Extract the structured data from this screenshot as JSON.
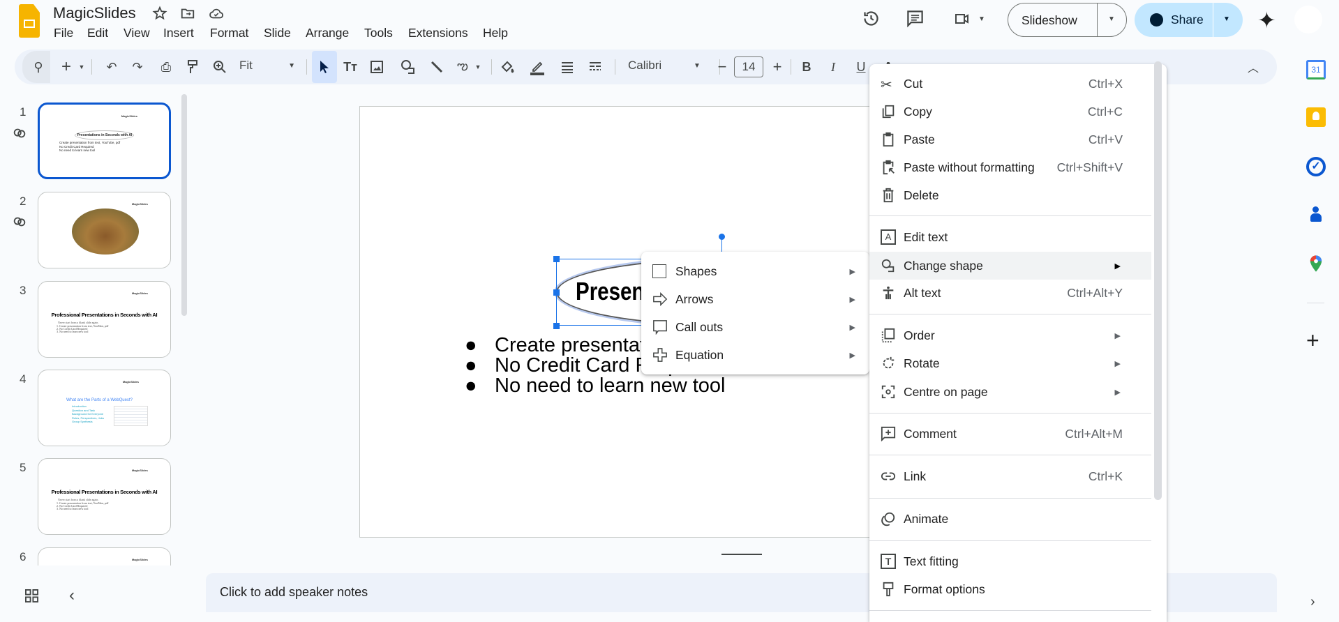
{
  "app": {
    "title": "MagicSlides",
    "menu": [
      "File",
      "Edit",
      "View",
      "Insert",
      "Format",
      "Slide",
      "Arrange",
      "Tools",
      "Extensions",
      "Help"
    ]
  },
  "header": {
    "slideshow_label": "Slideshow",
    "share_label": "Share"
  },
  "toolbar": {
    "zoom_value": "Fit",
    "font_name": "Calibri",
    "font_size": "14",
    "bold": "B",
    "italic": "I",
    "underline": "U"
  },
  "filmstrip": {
    "slides": [
      {
        "number": "1",
        "logo": "MagicSlides",
        "title": "Presentations in Seconds with AI",
        "bullets": [
          "Create presentation from text, YouTube, pdf",
          "No Credit Card Required",
          "No need to learn new tool"
        ]
      },
      {
        "number": "2",
        "logo": "MagicSlides"
      },
      {
        "number": "3",
        "logo": "MagicSlides",
        "title": "Professional Presentations in Seconds with AI",
        "subtitle": "Never start from a blank slide again.",
        "bullets": [
          "1. Create presentation from text, YouTube, pdf",
          "2. No Credit Card Required",
          "3. No need to learn new tool"
        ]
      },
      {
        "number": "4",
        "logo": "MagicSlides",
        "title": "What are the Parts of a WebQuest?",
        "bullets": [
          "Introduction",
          "Question and Task",
          "Background for Everyone",
          "Roles, Perspectives, Jobs",
          "Group Synthesis"
        ]
      },
      {
        "number": "5",
        "logo": "MagicSlides",
        "title": "Professional Presentations in Seconds with AI",
        "subtitle": "Never start from a blank slide again.",
        "bullets": [
          "1. Create presentation from text, YouTube, pdf",
          "2. No Credit Card Required",
          "3. No need to learn new tool"
        ]
      },
      {
        "number": "6",
        "logo": "MagicSlides"
      }
    ]
  },
  "slide": {
    "title": "Presentations in Seconds with AI",
    "bullets": [
      "Create presentation from text, YouTube, pdf",
      "No Credit Card Required",
      "No need to learn new tool"
    ]
  },
  "notes": {
    "placeholder": "Click to add speaker notes"
  },
  "context_menu": {
    "items": [
      {
        "label": "Cut",
        "shortcut": "Ctrl+X"
      },
      {
        "label": "Copy",
        "shortcut": "Ctrl+C"
      },
      {
        "label": "Paste",
        "shortcut": "Ctrl+V"
      },
      {
        "label": "Paste without formatting",
        "shortcut": "Ctrl+Shift+V"
      },
      {
        "label": "Delete"
      },
      {
        "label": "Edit text"
      },
      {
        "label": "Change shape"
      },
      {
        "label": "Alt text",
        "shortcut": "Ctrl+Alt+Y"
      },
      {
        "label": "Order"
      },
      {
        "label": "Rotate"
      },
      {
        "label": "Centre on page"
      },
      {
        "label": "Comment",
        "shortcut": "Ctrl+Alt+M"
      },
      {
        "label": "Link",
        "shortcut": "Ctrl+K"
      },
      {
        "label": "Animate"
      },
      {
        "label": "Text fitting"
      },
      {
        "label": "Format options"
      }
    ]
  },
  "submenu": {
    "items": [
      {
        "label": "Shapes"
      },
      {
        "label": "Arrows"
      },
      {
        "label": "Call outs"
      },
      {
        "label": "Equation"
      }
    ]
  },
  "colors": {
    "accent": "#0b57d0",
    "share_bg": "#c2e7ff",
    "toolbar_bg": "#edf2fa",
    "selected_tool": "#d3e3fd",
    "highlight": "#f1f3f4"
  }
}
